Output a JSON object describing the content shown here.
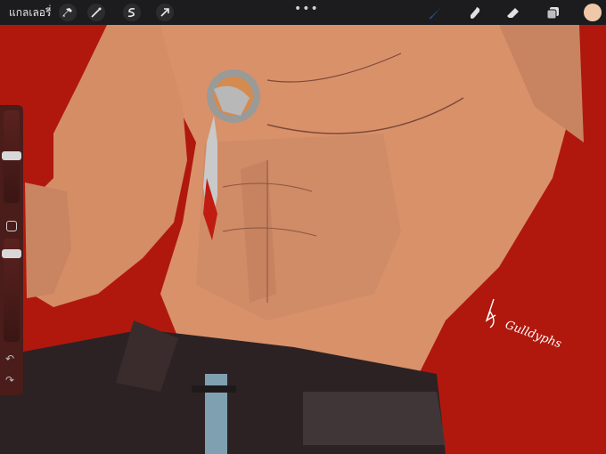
{
  "topbar": {
    "gallery_label": "แกลเลอรี่",
    "more_glyph": "•••",
    "left_tools": [
      "wrench-icon",
      "magic-wand-icon",
      "selection-icon",
      "transform-arrow-icon"
    ],
    "right_tools": [
      "brush-icon",
      "smudge-icon",
      "eraser-icon",
      "layers-icon"
    ],
    "brush_color": "#2f6fd6",
    "current_color": "#f0c8a8"
  },
  "sidebar": {
    "undo_glyph": "↶",
    "redo_glyph": "↷"
  },
  "canvas": {
    "background_color": "#b0180e",
    "signature_text": "Gulldyphs"
  }
}
